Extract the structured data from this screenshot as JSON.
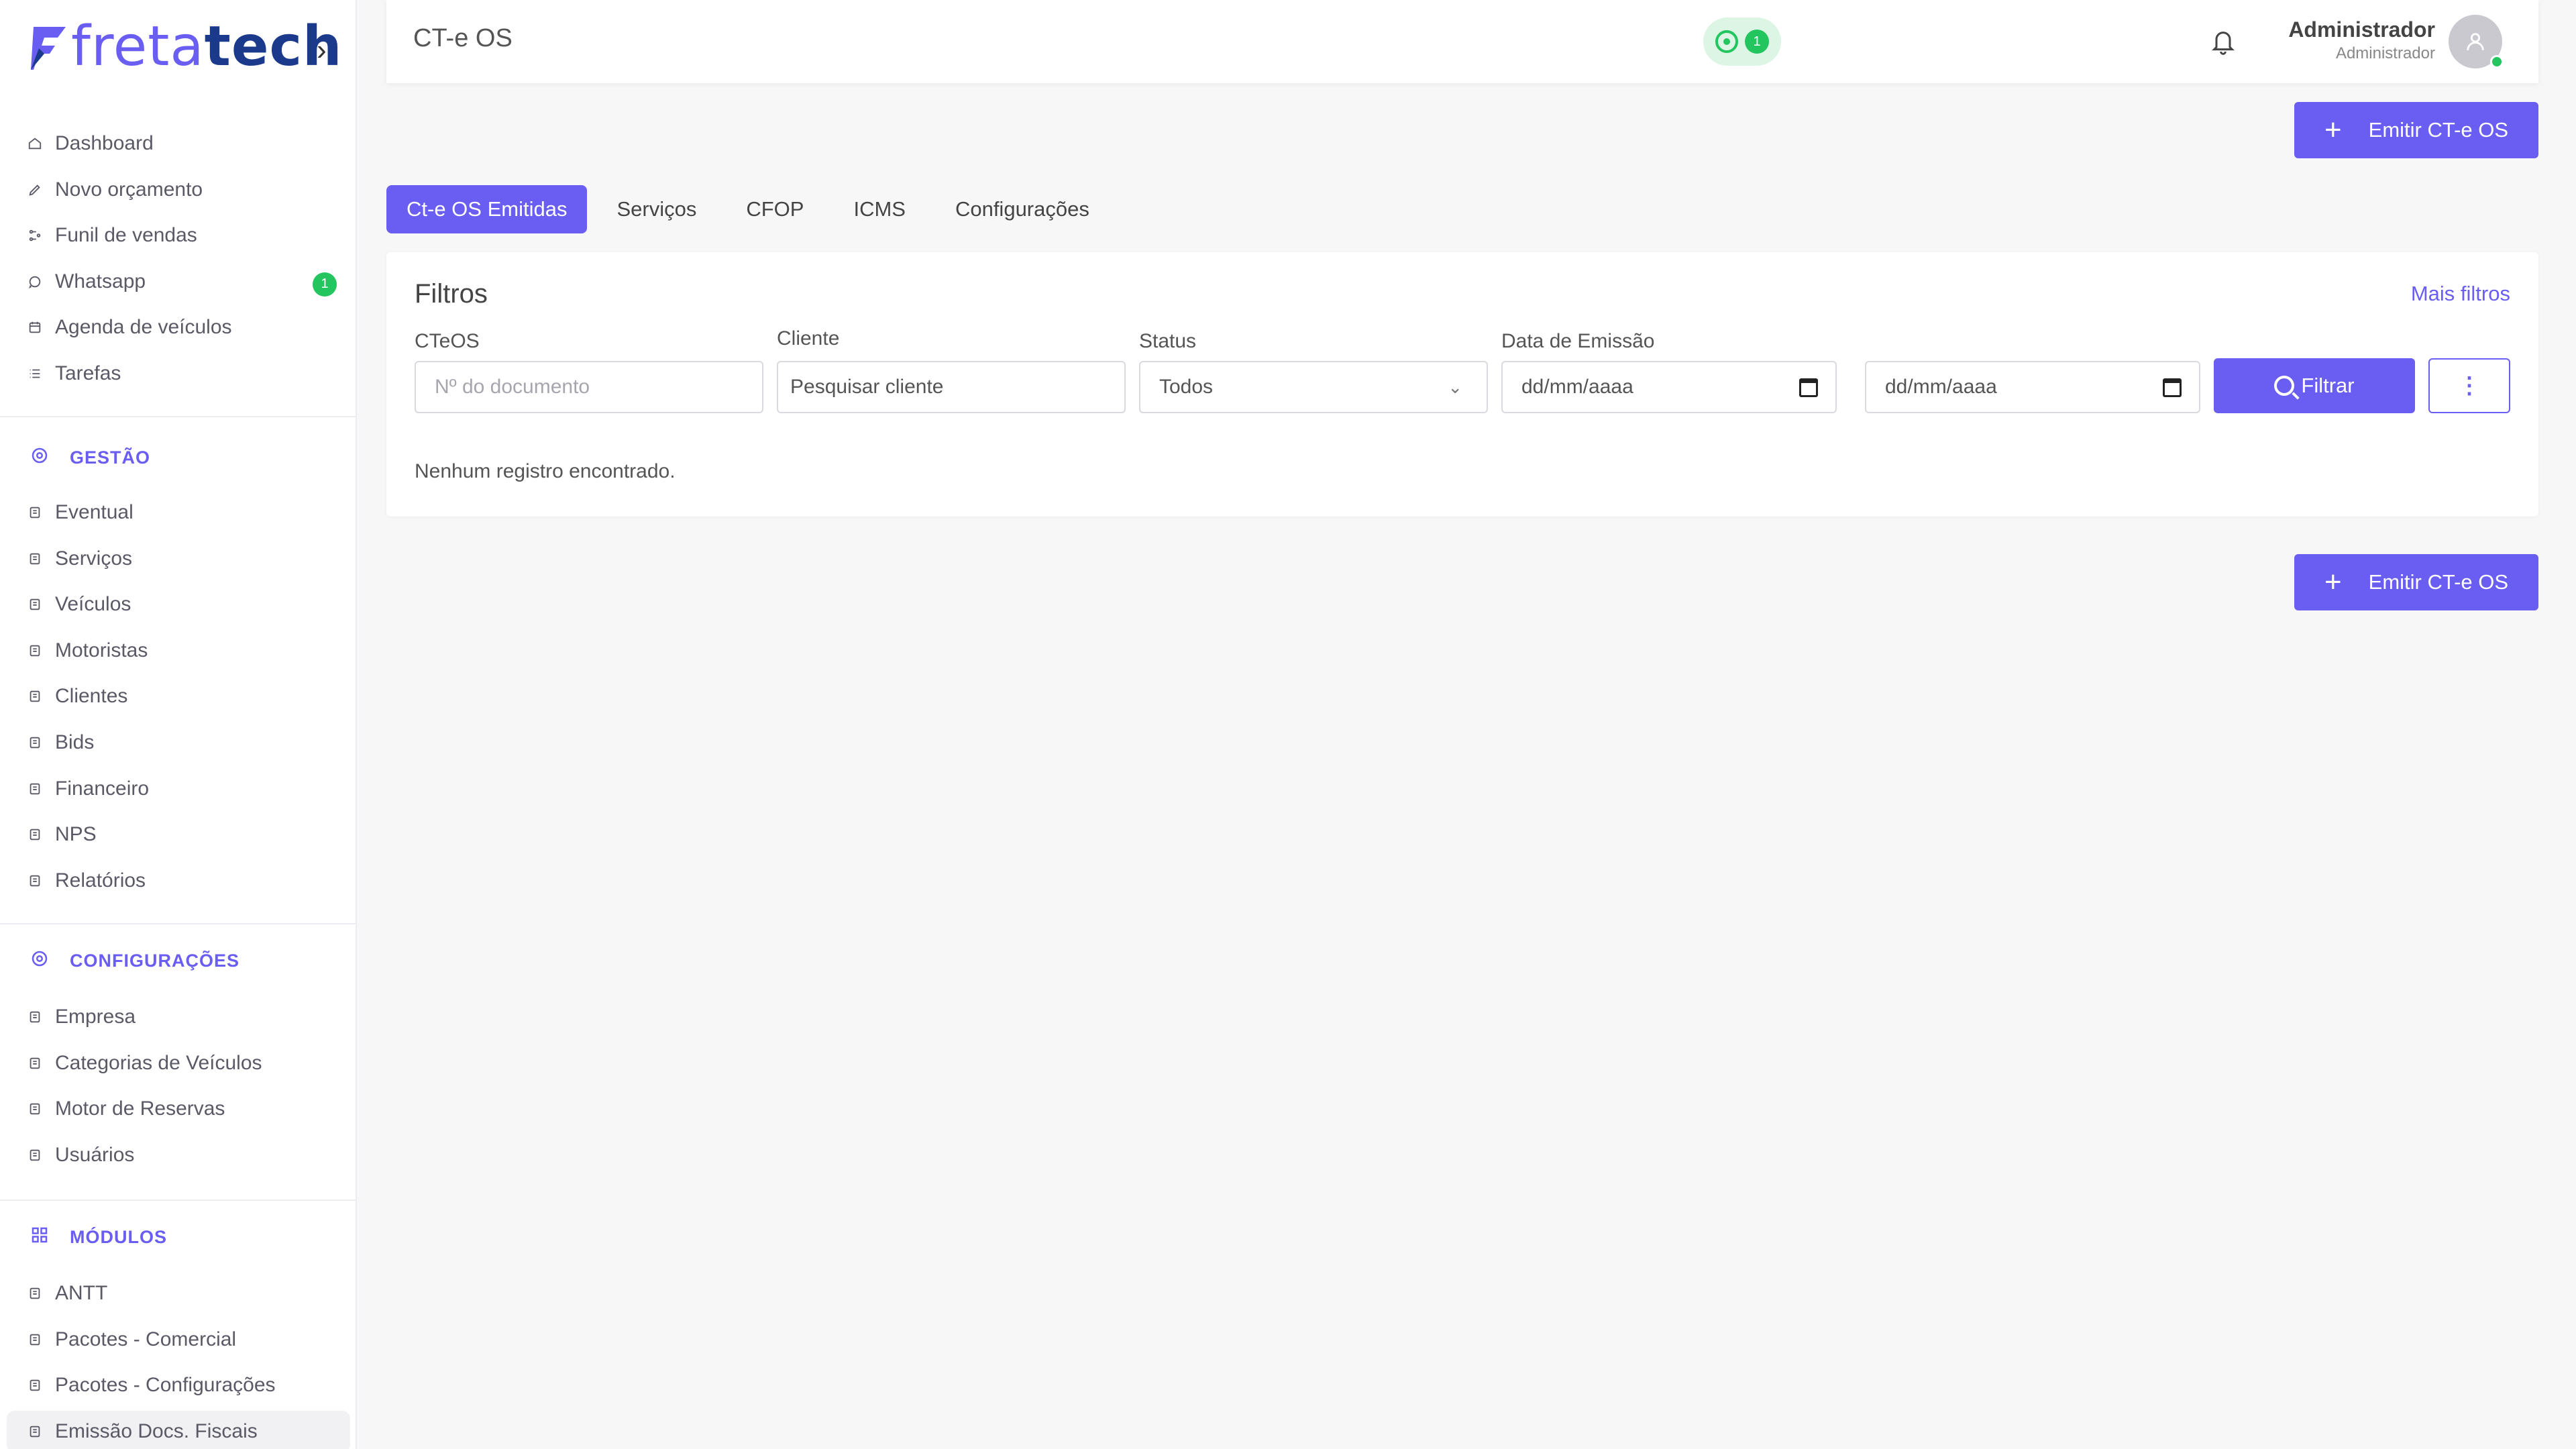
{
  "brand": {
    "name_part1": "freta",
    "name_part2": "tech",
    "chevron": "›"
  },
  "sidebar": {
    "main_items": [
      {
        "label": "Dashboard",
        "icon": "home-icon"
      },
      {
        "label": "Novo orçamento",
        "icon": "edit-icon"
      },
      {
        "label": "Funil de vendas",
        "icon": "funnel-icon"
      },
      {
        "label": "Whatsapp",
        "icon": "whatsapp-icon",
        "badge": "1"
      },
      {
        "label": "Agenda de veículos",
        "icon": "calendar-icon"
      },
      {
        "label": "Tarefas",
        "icon": "list-icon"
      }
    ],
    "sections": [
      {
        "title": "GESTÃO",
        "items": [
          "Eventual",
          "Serviços",
          "Veículos",
          "Motoristas",
          "Clientes",
          "Bids",
          "Financeiro",
          "NPS",
          "Relatórios"
        ]
      },
      {
        "title": "CONFIGURAÇÕES",
        "items": [
          "Empresa",
          "Categorias de Veículos",
          "Motor de Reservas",
          "Usuários"
        ]
      },
      {
        "title": "MÓDULOS",
        "items": [
          "ANTT",
          "Pacotes - Comercial",
          "Pacotes - Configurações",
          "Emissão Docs. Fiscais"
        ]
      }
    ]
  },
  "header": {
    "title": "CT-e OS",
    "whatsapp_count": "1",
    "user_name": "Administrador",
    "user_role": "Administrador"
  },
  "actions": {
    "emit_label": "Emitir CT-e OS"
  },
  "tabs": [
    "Ct-e OS Emitidas",
    "Serviços",
    "CFOP",
    "ICMS",
    "Configurações"
  ],
  "filters": {
    "title": "Filtros",
    "more": "Mais filtros",
    "cteos_label": "CTeOS",
    "cteos_placeholder": "Nº do documento",
    "client_label": "Cliente",
    "client_placeholder": "Pesquisar cliente",
    "status_label": "Status",
    "status_value": "Todos",
    "date_label": "Data de Emissão",
    "date_placeholder": "dd/mm/aaaa",
    "filter_button": "Filtrar",
    "kebab": "⋮"
  },
  "results": {
    "empty": "Nenhum registro encontrado."
  },
  "colors": {
    "accent": "#6a5df2",
    "success": "#22c55e"
  }
}
